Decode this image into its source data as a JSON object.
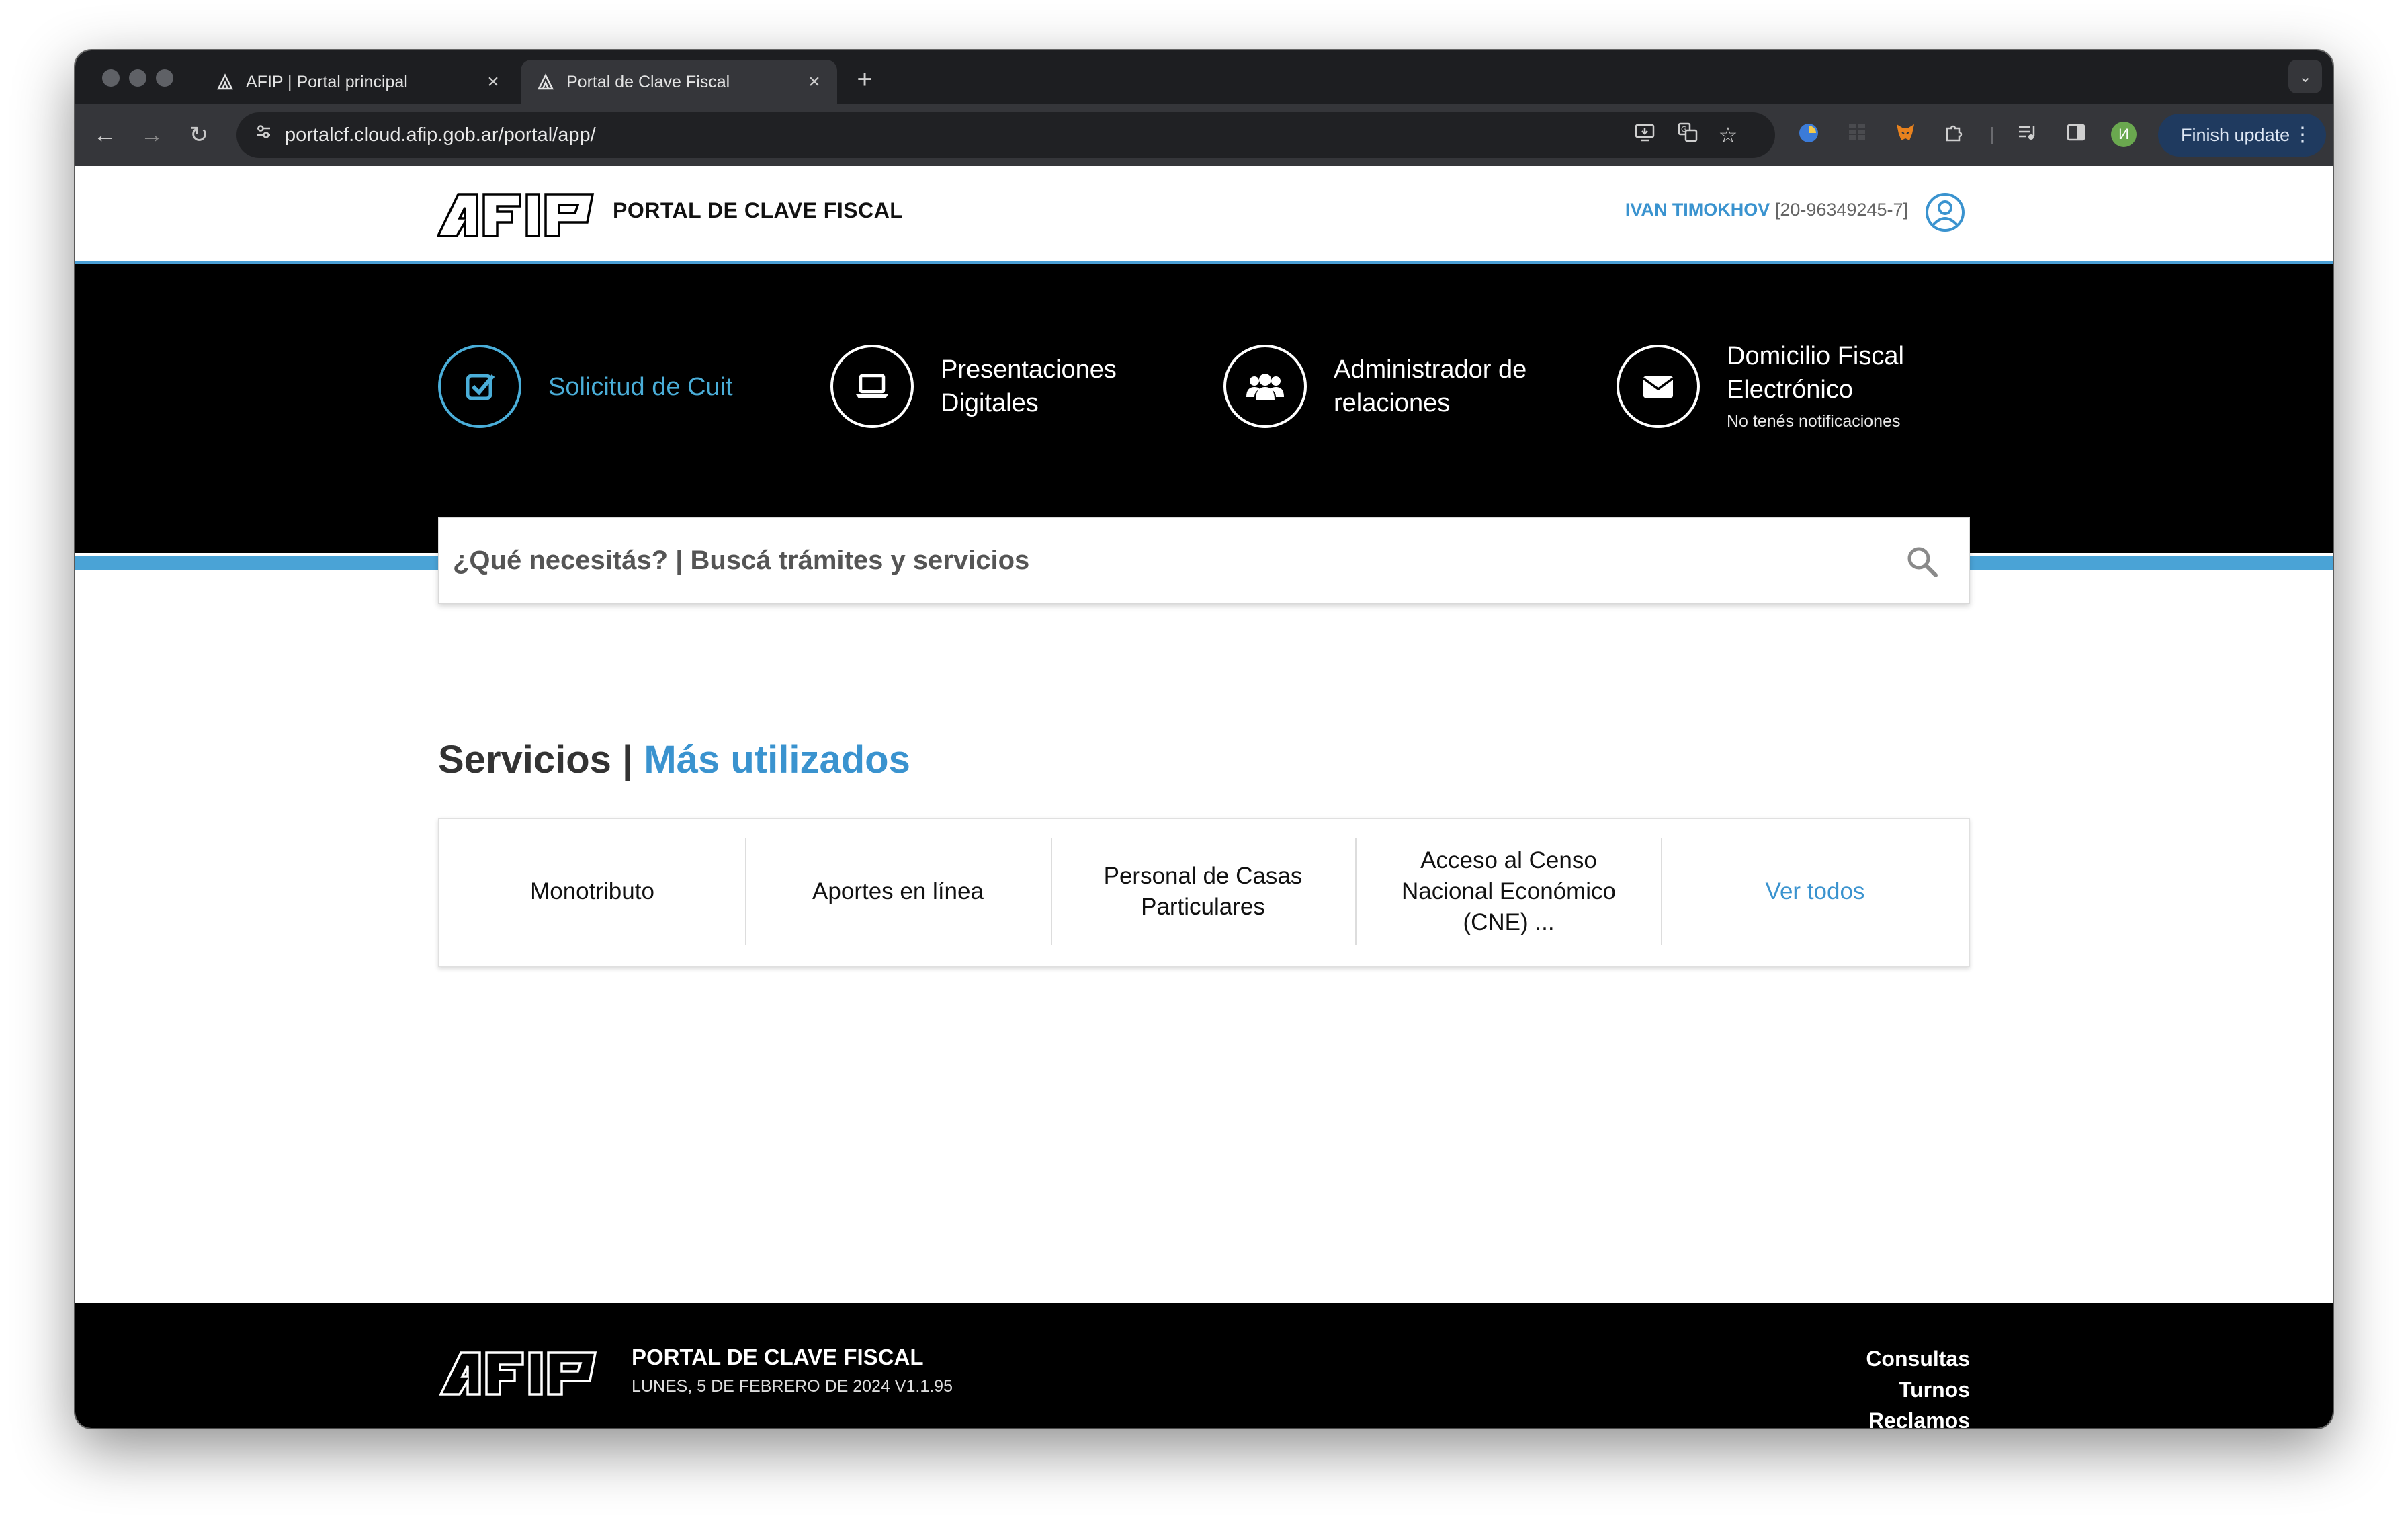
{
  "browser": {
    "tabs": [
      {
        "title": "AFIP | Portal principal",
        "active": false
      },
      {
        "title": "Portal de Clave Fiscal",
        "active": true
      }
    ],
    "new_tab_symbol": "+",
    "tab_close_symbol": "×",
    "url": "portalcf.cloud.afip.gob.ar/portal/app/",
    "finish_update_label": "Finish update",
    "profile_initial": "И"
  },
  "header": {
    "site_title": "PORTAL DE CLAVE FISCAL",
    "user_name": "IVAN TIMOKHOV",
    "user_cuit": "[20-96349245-7]"
  },
  "shortcuts": [
    {
      "line1": "Solicitud de Cuit",
      "line2": "",
      "sub": "",
      "icon": "checkbox-icon",
      "accent": "#4aaed9"
    },
    {
      "line1": "Presentaciones",
      "line2": "Digitales",
      "sub": "",
      "icon": "laptop-icon"
    },
    {
      "line1": "Administrador de",
      "line2": "relaciones",
      "sub": "",
      "icon": "users-icon"
    },
    {
      "line1": "Domicilio Fiscal",
      "line2": "Electrónico",
      "sub": "No tenés notificaciones",
      "icon": "envelope-icon"
    }
  ],
  "search": {
    "placeholder": "¿Qué necesitás? | Buscá trámites y servicios"
  },
  "services": {
    "title_main": "Servicios |",
    "title_accent": "Más utilizados",
    "items": [
      {
        "label": "Monotributo"
      },
      {
        "label": "Aportes en línea"
      },
      {
        "label": "Personal de Casas Particulares"
      },
      {
        "label": "Acceso al Censo Nacional Económico (CNE) ..."
      }
    ],
    "see_all": "Ver todos"
  },
  "footer": {
    "title": "PORTAL DE CLAVE FISCAL",
    "date": "LUNES, 5 DE FEBRERO DE 2024 V1.1.95",
    "links": [
      "Consultas",
      "Turnos",
      "Reclamos"
    ]
  },
  "colors": {
    "accent_blue": "#3a93cf",
    "strip_blue": "#4aa3d6",
    "hero_bg": "#000000"
  }
}
